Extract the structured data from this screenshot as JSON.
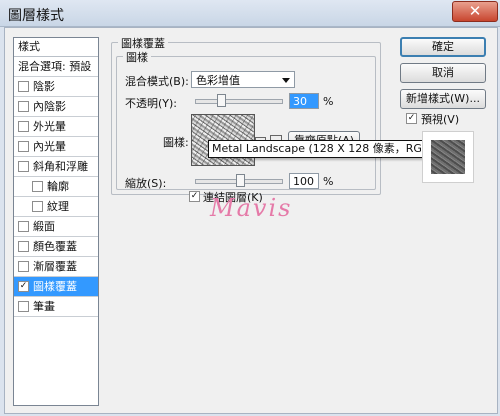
{
  "window": {
    "title": "圖層樣式",
    "close_glyph": "✕"
  },
  "styles_list": {
    "header": "樣式",
    "blend_options": "混合選項: 預設",
    "items": [
      {
        "label": "陰影",
        "checked": false,
        "indent": false,
        "selected": false
      },
      {
        "label": "內陰影",
        "checked": false,
        "indent": false,
        "selected": false
      },
      {
        "label": "外光暈",
        "checked": false,
        "indent": false,
        "selected": false
      },
      {
        "label": "內光暈",
        "checked": false,
        "indent": false,
        "selected": false
      },
      {
        "label": "斜角和浮雕",
        "checked": false,
        "indent": false,
        "selected": false
      },
      {
        "label": "輪廓",
        "checked": false,
        "indent": true,
        "selected": false
      },
      {
        "label": "紋理",
        "checked": false,
        "indent": true,
        "selected": false
      },
      {
        "label": "緞面",
        "checked": false,
        "indent": false,
        "selected": false
      },
      {
        "label": "顏色覆蓋",
        "checked": false,
        "indent": false,
        "selected": false
      },
      {
        "label": "漸層覆蓋",
        "checked": false,
        "indent": false,
        "selected": false
      },
      {
        "label": "圖樣覆蓋",
        "checked": true,
        "indent": false,
        "selected": true
      },
      {
        "label": "筆畫",
        "checked": false,
        "indent": false,
        "selected": false
      }
    ]
  },
  "pattern_overlay": {
    "section_title": "圖樣覆蓋",
    "subsection_title": "圖樣",
    "blend_mode_label": "混合模式(B):",
    "blend_mode_value": "色彩增值",
    "opacity_label": "不透明(Y):",
    "opacity_value": "30",
    "opacity_fraction": 0.3,
    "percent": "%",
    "pattern_label": "圖樣:",
    "snap_button": "靠齊原點(A)",
    "tooltip": "Metal Landscape (128 X 128 像素，RGB 模式)",
    "scale_label": "縮放(S):",
    "scale_value": "100",
    "scale_fraction": 0.1,
    "link_layer_label": "連結圖層(K)",
    "link_layer_checked": true
  },
  "buttons": {
    "ok": "確定",
    "cancel": "取消",
    "new_style": "新增樣式(W)...",
    "preview_label": "預視(V)",
    "preview_checked": true
  },
  "watermark": "Mavis",
  "icons": {
    "checkmark": "✓",
    "chevron": "▸"
  }
}
